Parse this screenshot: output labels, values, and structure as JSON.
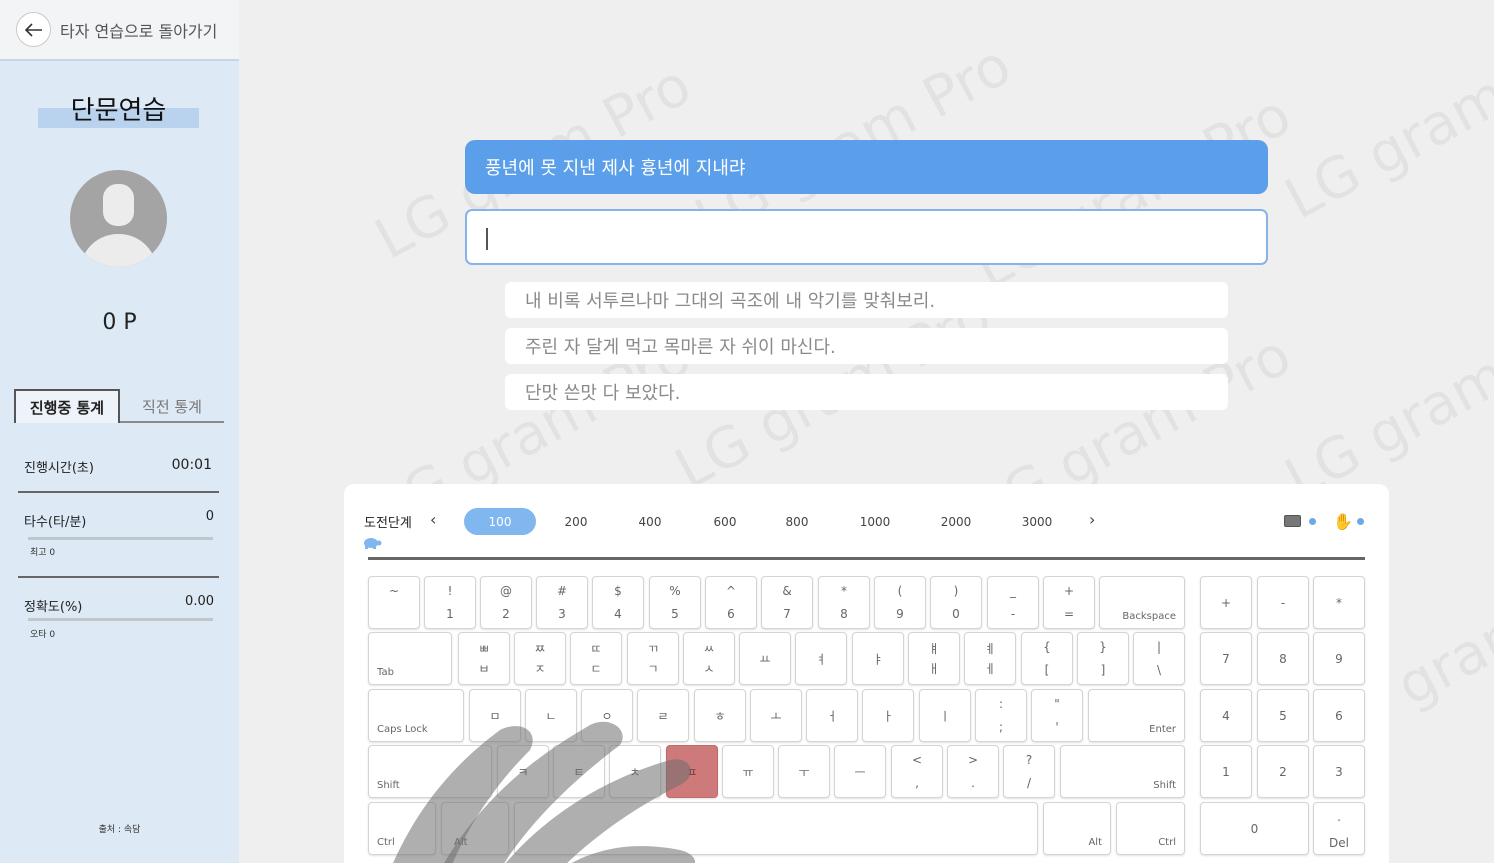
{
  "sidebar": {
    "back_label": "타자 연습으로 돌아가기",
    "title": "단문연습",
    "points": "0 P",
    "tabs": [
      "진행중 통계",
      "직전 통계"
    ],
    "stats": {
      "time_label": "진행시간(초)",
      "time_value": "00:01",
      "speed_label": "타수(타/분)",
      "speed_value": "0",
      "speed_sub": "최고 0",
      "accuracy_label": "정확도(%)",
      "accuracy_value": "0.00",
      "accuracy_sub": "오타 0"
    },
    "source": "출처 : 속담"
  },
  "watermark": "LG gram Pro",
  "practice": {
    "current_sentence": "풍년에 못 지낸 제사 흉년에 지내랴",
    "input_value": "",
    "next_sentences": [
      "내 비록 서투르나마 그대의 곡조에 내 악기를 맞춰보리.",
      "주린 자 달게 먹고 목마른 자 쉬이 마신다.",
      "단맛 쓴맛 다 보았다."
    ]
  },
  "keyboard": {
    "level_label": "도전단계",
    "levels": [
      "100",
      "200",
      "400",
      "600",
      "800",
      "1000",
      "2000",
      "3000"
    ],
    "active_level": "100",
    "prev_arrow": "‹",
    "next_arrow": "›",
    "rows": {
      "r1": [
        [
          "~",
          ""
        ],
        [
          "!",
          "1"
        ],
        [
          "@",
          "2"
        ],
        [
          "#",
          "3"
        ],
        [
          "$",
          "4"
        ],
        [
          "%",
          "5"
        ],
        [
          "^",
          "6"
        ],
        [
          "&",
          "7"
        ],
        [
          "*",
          "8"
        ],
        [
          "(",
          "9"
        ],
        [
          ")",
          "0"
        ],
        [
          "_",
          "-"
        ],
        [
          "+",
          "="
        ]
      ],
      "backspace": "Backspace",
      "tab": "Tab",
      "r2": [
        [
          "ㅃ",
          "ㅂ"
        ],
        [
          "ㅉ",
          "ㅈ"
        ],
        [
          "ㄸ",
          "ㄷ"
        ],
        [
          "ㄲ",
          "ㄱ"
        ],
        [
          "ㅆ",
          "ㅅ"
        ],
        [
          "",
          "ㅛ"
        ],
        [
          "",
          "ㅕ"
        ],
        [
          "",
          "ㅑ"
        ],
        [
          "ㅒ",
          "ㅐ"
        ],
        [
          "ㅖ",
          "ㅔ"
        ],
        [
          "{",
          "["
        ],
        [
          "}",
          "]"
        ],
        [
          "|",
          "\\"
        ]
      ],
      "capslock": "Caps Lock",
      "r3": [
        "ㅁ",
        "ㄴ",
        "ㅇ",
        "ㄹ",
        "ㅎ",
        "ㅗ",
        "ㅓ",
        "ㅏ",
        "ㅣ",
        [
          ":",
          ";"
        ],
        [
          "\"",
          "'"
        ]
      ],
      "enter": "Enter",
      "shift": "Shift",
      "r4": [
        "ㅋ",
        "ㅌ",
        "ㅊ",
        "ㅍ",
        "ㅠ",
        "ㅜ",
        "ㅡ",
        [
          "<",
          ","
        ],
        [
          ">",
          "."
        ],
        [
          "?",
          "/"
        ]
      ],
      "ctrl": "Ctrl",
      "alt": "Alt",
      "numpad": {
        "r1": [
          "+",
          "-",
          "*"
        ],
        "r2": [
          "7",
          "8",
          "9"
        ],
        "r3": [
          "4",
          "5",
          "6"
        ],
        "r4": [
          "1",
          "2",
          "3"
        ],
        "zero": "0",
        "del_top": ".",
        "del": "Del"
      }
    },
    "highlight_key": "ㅍ"
  },
  "colors": {
    "sidebar_bg": "#dde9f5",
    "accent": "#5b9fea",
    "highlight": "#cf7a7a"
  }
}
